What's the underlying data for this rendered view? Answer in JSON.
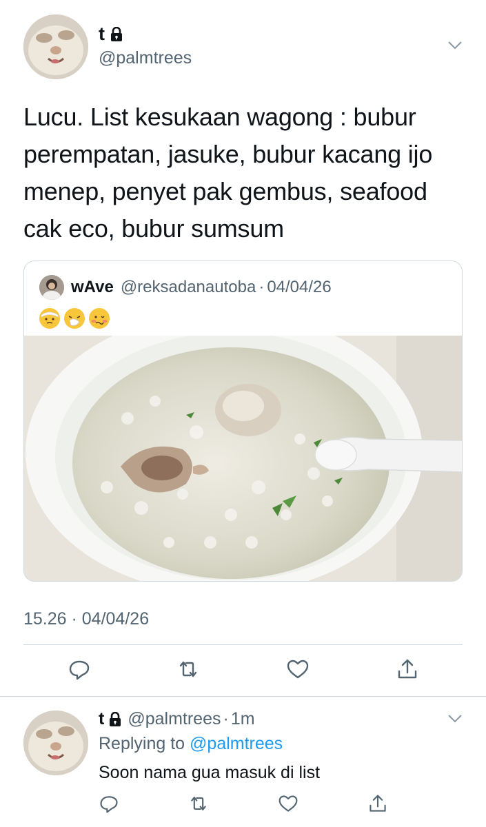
{
  "main_tweet": {
    "display_name": "t",
    "handle": "@palmtrees",
    "text": "Lucu. List kesukaan wagong : bubur perempatan, jasuke, bubur kacang ijo menep, penyet pak gembus, seafood cak eco, bubur sumsum",
    "timestamp": "15.26 · 04/04/26",
    "icons": [
      "lock-icon",
      "chevron-down-icon",
      "reply-icon",
      "retweet-icon",
      "like-icon",
      "share-icon"
    ]
  },
  "quoted_tweet": {
    "display_name": "wAve",
    "handle": "@reksadanautoba",
    "separator": "·",
    "date": "04/04/26",
    "emojis": [
      "face-with-head-bandage",
      "sneezing-face",
      "woozy-face"
    ]
  },
  "reply_tweet": {
    "display_name": "t",
    "handle": "@palmtrees",
    "separator": "·",
    "time": "1m",
    "replying_prefix": "Replying to",
    "replying_to": "@palmtrees",
    "text": "Soon nama gua masuk di list"
  },
  "colors": {
    "text": "#0f1419",
    "secondary": "#536471",
    "link": "#1d9bf0",
    "border": "#cfd9de"
  }
}
